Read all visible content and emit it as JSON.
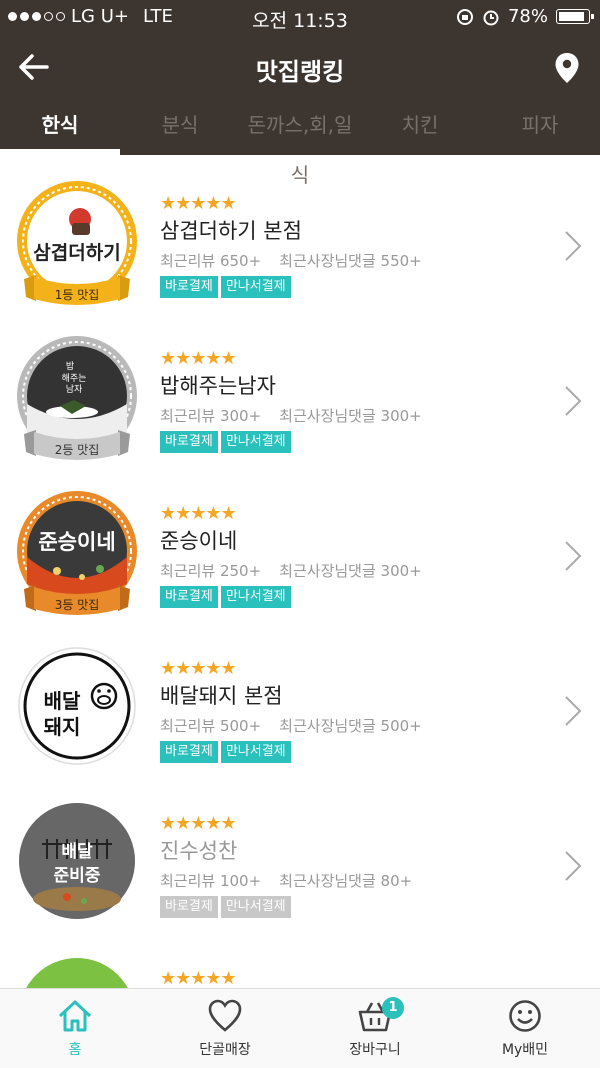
{
  "status": {
    "carrier": "LG U+",
    "network": "LTE",
    "time": "오전 11:53",
    "battery": "78%",
    "battery_level": 0.78
  },
  "header": {
    "title": "맛집랭킹"
  },
  "tabs": [
    "한식",
    "분식",
    "돈까스,회,일식",
    "치킨",
    "피자"
  ],
  "active_tab": 0,
  "stores": [
    {
      "name": "삼겹더하기 본점",
      "rank_label": "1등 맛집",
      "stars": "★★★★★",
      "rating": 4.5,
      "reviews": "최근리뷰 650+",
      "owner_replies": "최근사장님댓글 550+",
      "pay_direct": "바로결제",
      "pay_meet": "만나서결제",
      "logo_text": "삼겹더하기",
      "open": true
    },
    {
      "name": "밥해주는남자",
      "rank_label": "2등 맛집",
      "stars": "★★★★★",
      "rating": 4.5,
      "reviews": "최근리뷰 300+",
      "owner_replies": "최근사장님댓글 300+",
      "pay_direct": "바로결제",
      "pay_meet": "만나서결제",
      "logo_text": "밥해주는남자",
      "open": true
    },
    {
      "name": "준승이네",
      "rank_label": "3등 맛집",
      "stars": "★★★★★",
      "rating": 4.5,
      "reviews": "최근리뷰 250+",
      "owner_replies": "최근사장님댓글 300+",
      "pay_direct": "바로결제",
      "pay_meet": "만나서결제",
      "logo_text": "준승이네",
      "open": true
    },
    {
      "name": "배달돼지 본점",
      "rank_label": "",
      "stars": "★★★★★",
      "rating": 4.5,
      "reviews": "최근리뷰 500+",
      "owner_replies": "최근사장님댓글 500+",
      "pay_direct": "바로결제",
      "pay_meet": "만나서결제",
      "logo_text": "배달돼지",
      "open": true
    },
    {
      "name": "진수성찬",
      "rank_label": "",
      "stars": "★★★★★",
      "rating": 4.5,
      "reviews": "최근리뷰 100+",
      "owner_replies": "최근사장님댓글 80+",
      "pay_direct": "바로결제",
      "pay_meet": "만나서결제",
      "logo_text": "배달\n준비중",
      "open": false
    }
  ],
  "partial_item": {
    "stars": "★★★★★"
  },
  "tabbar": [
    {
      "label": "홈",
      "icon": "home-icon"
    },
    {
      "label": "단골매장",
      "icon": "heart-icon"
    },
    {
      "label": "장바구니",
      "icon": "basket-icon",
      "badge": "1"
    },
    {
      "label": "My배민",
      "icon": "smiley-icon"
    }
  ],
  "colors": {
    "brand_dark": "#3d3530",
    "accent": "#2ac1bc",
    "star": "#f5a623"
  }
}
